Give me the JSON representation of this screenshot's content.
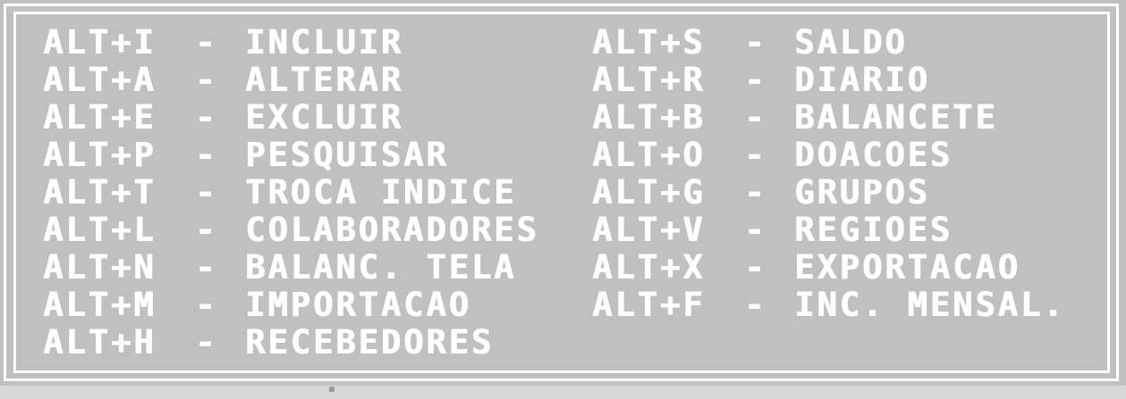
{
  "colors": {
    "background": "#c0c0c0",
    "text": "#ffffff",
    "frame": "#ffffff"
  },
  "menu": {
    "left": [
      {
        "key": "ALT+I",
        "sep": "-",
        "label": "INCLUIR"
      },
      {
        "key": "ALT+A",
        "sep": "-",
        "label": "ALTERAR"
      },
      {
        "key": "ALT+E",
        "sep": "-",
        "label": "EXCLUIR"
      },
      {
        "key": "ALT+P",
        "sep": "-",
        "label": "PESQUISAR"
      },
      {
        "key": "ALT+T",
        "sep": "-",
        "label": "TROCA INDICE"
      },
      {
        "key": "ALT+L",
        "sep": "-",
        "label": "COLABORADORES"
      },
      {
        "key": "ALT+N",
        "sep": "-",
        "label": "BALANC. TELA"
      },
      {
        "key": "ALT+M",
        "sep": "-",
        "label": "IMPORTACAO"
      },
      {
        "key": "ALT+H",
        "sep": "-",
        "label": "RECEBEDORES"
      }
    ],
    "right": [
      {
        "key": "ALT+S",
        "sep": "-",
        "label": "SALDO"
      },
      {
        "key": "ALT+R",
        "sep": "-",
        "label": "DIARIO"
      },
      {
        "key": "ALT+B",
        "sep": "-",
        "label": "BALANCETE"
      },
      {
        "key": "ALT+O",
        "sep": "-",
        "label": "DOACOES"
      },
      {
        "key": "ALT+G",
        "sep": "-",
        "label": "GRUPOS"
      },
      {
        "key": "ALT+V",
        "sep": "-",
        "label": "REGIOES"
      },
      {
        "key": "ALT+X",
        "sep": "-",
        "label": "EXPORTACAO"
      },
      {
        "key": "ALT+F",
        "sep": "-",
        "label": "INC. MENSAL."
      }
    ]
  }
}
